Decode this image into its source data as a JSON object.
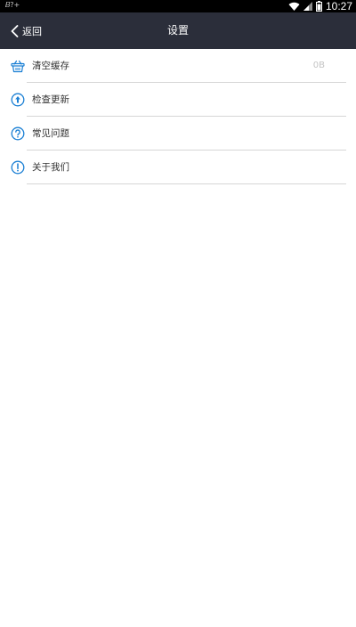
{
  "status_bar": {
    "left_text": "𝐵?+",
    "time": "10:27",
    "colors": {
      "background": "#000000",
      "text": "#ffffff"
    }
  },
  "nav": {
    "back_label": "返回",
    "title": "设置",
    "colors": {
      "background": "#2b2e3a",
      "text": "#ffffff"
    }
  },
  "menu": {
    "items": [
      {
        "icon": "basket-icon",
        "label": "清空缓存",
        "value": "0B"
      },
      {
        "icon": "upgrade-icon",
        "label": "检查更新"
      },
      {
        "icon": "question-icon",
        "label": "常见问题"
      },
      {
        "icon": "info-icon",
        "label": "关于我们"
      }
    ],
    "colors": {
      "icon": "#1a7fd4",
      "label": "#333333",
      "value": "#c4c4c4",
      "divider": "#d6d6d6"
    }
  }
}
